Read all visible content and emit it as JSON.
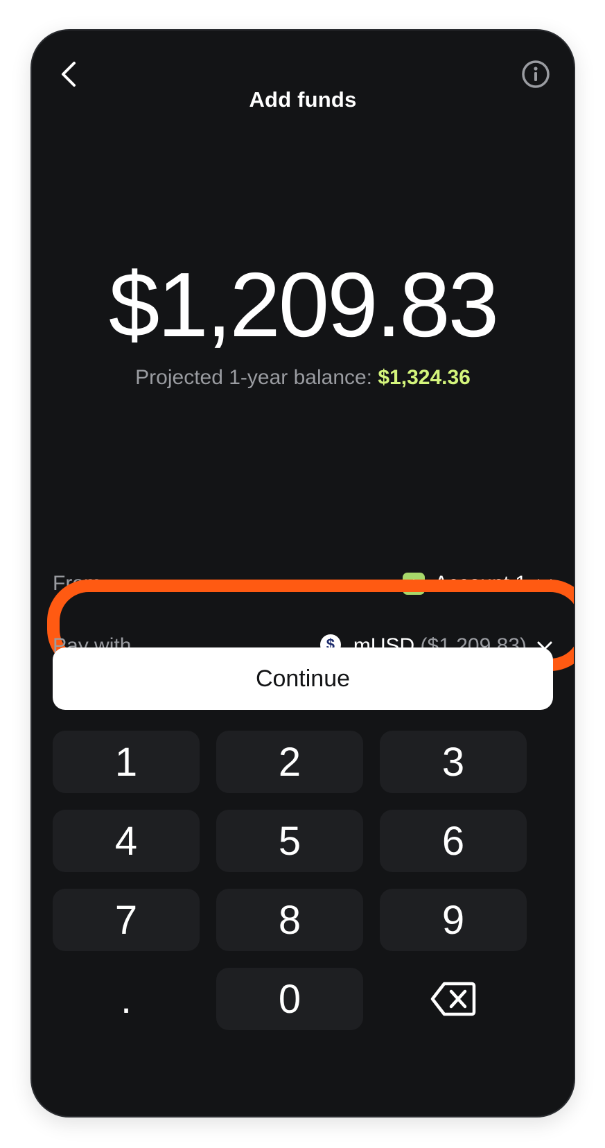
{
  "header": {
    "title": "Add funds"
  },
  "amount": "$1,209.83",
  "projected": {
    "label": "Projected 1-year balance:",
    "value": "$1,324.36"
  },
  "from": {
    "label": "From",
    "account": "Account 1",
    "icon": "account-icon"
  },
  "pay_with": {
    "label": "Pay with",
    "token": "mUSD",
    "balance": "($1,209.83)",
    "icon": "musd-token-icon",
    "highlight_color": "#ff5a12"
  },
  "continue_label": "Continue",
  "keypad": {
    "k1": "1",
    "k2": "2",
    "k3": "3",
    "k4": "4",
    "k5": "5",
    "k6": "6",
    "k7": "7",
    "k8": "8",
    "k9": "9",
    "kdot": ".",
    "k0": "0",
    "backspace_icon": "backspace-icon"
  },
  "colors": {
    "background": "#131416",
    "accent_green": "#d4f57c",
    "highlight": "#ff5a12"
  }
}
